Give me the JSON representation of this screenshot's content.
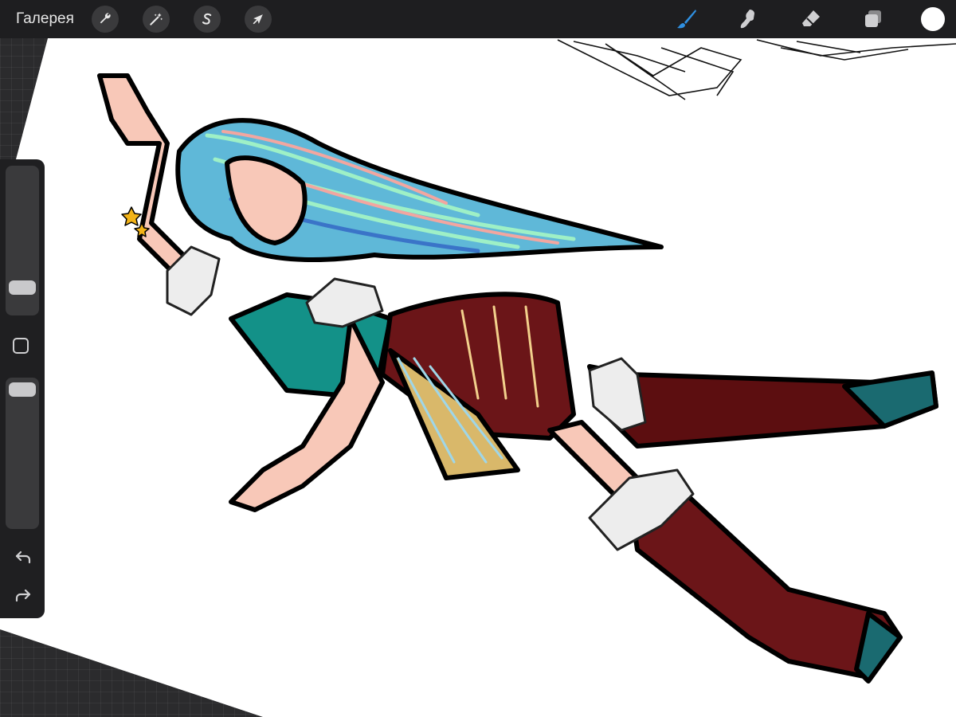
{
  "toolbar": {
    "gallery_label": "Галерея",
    "actions_icon": "wrench-icon",
    "adjustments_icon": "magic-wand-icon",
    "selection_icon": "selection-s-icon",
    "transform_icon": "arrow-cursor-icon",
    "brush_icon": "brush-icon",
    "smudge_icon": "smudge-icon",
    "eraser_icon": "eraser-icon",
    "layers_icon": "layers-icon",
    "active_tool": "brush",
    "brush_color": "#2f8fe0",
    "current_color": "#ffffff"
  },
  "sidebar": {
    "brush_size_level": 0.18,
    "opacity_level": 0.9,
    "undo_icon": "undo-icon",
    "redo_icon": "redo-icon",
    "modify_icon": "square-icon"
  },
  "canvas": {
    "paper_color": "#ffffff",
    "artwork": "illustration-flying-girl"
  }
}
